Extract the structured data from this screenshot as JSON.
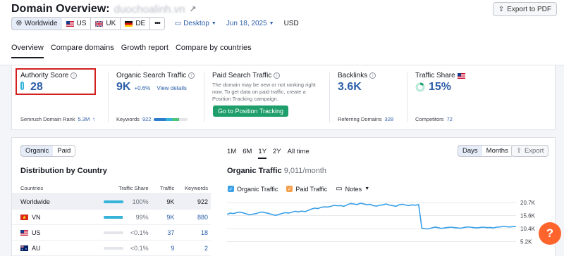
{
  "header": {
    "title": "Domain Overview:",
    "domain": "duochoalinh.vn",
    "export_label": "Export to PDF"
  },
  "controls": {
    "databases": [
      {
        "label": "Worldwide",
        "selected": true
      },
      {
        "label": "US",
        "selected": false
      },
      {
        "label": "UK",
        "selected": false
      },
      {
        "label": "DE",
        "selected": false
      }
    ],
    "more_label": "•••",
    "device": "Desktop",
    "date": "Jun 18, 2025",
    "currency": "USD"
  },
  "tabs": [
    "Overview",
    "Compare domains",
    "Growth report",
    "Compare by countries"
  ],
  "active_tab": "Overview",
  "metrics": {
    "authority": {
      "label": "Authority Score",
      "value": "28",
      "foot_label": "Semrush Domain Rank",
      "foot_value": "5.3M",
      "foot_arrow": "↑"
    },
    "organic": {
      "label": "Organic Search Traffic",
      "value": "9K",
      "delta": "+0.6%",
      "link": "View details",
      "foot_label": "Keywords",
      "foot_value": "922"
    },
    "paid": {
      "label": "Paid Search Traffic",
      "text": "The domain may be new or not ranking right now. To get data on paid traffic, create a Position Tracking campaign.",
      "button": "Go to Position Tracking"
    },
    "backlinks": {
      "label": "Backlinks",
      "value": "3.6K",
      "foot_label": "Referring Domains",
      "foot_value": "328"
    },
    "share": {
      "label": "Traffic Share",
      "value": "15%",
      "share_fraction": 0.15,
      "foot_label": "Competitors",
      "foot_value": "72"
    }
  },
  "panel": {
    "toggle": [
      {
        "label": "Organic",
        "selected": true
      },
      {
        "label": "Paid",
        "selected": false
      }
    ],
    "distribution_title": "Distribution by Country",
    "table_headers": {
      "country": "Countries",
      "share": "Traffic Share",
      "traffic": "Traffic",
      "keywords": "Keywords"
    },
    "rows": [
      {
        "country": "Worldwide",
        "flag": "none",
        "share": "100%",
        "share_fill": 1.0,
        "traffic": "9K",
        "keywords": "922",
        "linked": false
      },
      {
        "country": "VN",
        "flag": "vn",
        "share": "99%",
        "share_fill": 0.99,
        "traffic": "9K",
        "keywords": "880",
        "linked": true
      },
      {
        "country": "US",
        "flag": "us",
        "share": "<0.1%",
        "share_fill": 0.0,
        "traffic": "37",
        "keywords": "18",
        "linked": true
      },
      {
        "country": "AU",
        "flag": "au",
        "share": "<0.1%",
        "share_fill": 0.0,
        "traffic": "9",
        "keywords": "2",
        "linked": true
      }
    ],
    "ranges": [
      "1M",
      "6M",
      "1Y",
      "2Y",
      "All time"
    ],
    "active_range": "1Y",
    "granularity": [
      {
        "label": "Days",
        "selected": true
      },
      {
        "label": "Months",
        "selected": false
      }
    ],
    "export_label": "Export",
    "chart_title": "Organic Traffic",
    "chart_subtitle": "9,011/month",
    "legend": [
      {
        "label": "Organic Traffic",
        "color": "#3aa0e8",
        "checked": true
      },
      {
        "label": "Paid Traffic",
        "color": "#f5a04a",
        "checked": true
      }
    ],
    "notes_label": "Notes",
    "help_label": "?"
  },
  "chart_data": {
    "type": "line",
    "title": "Organic Traffic",
    "y_ticks": [
      "20.7K",
      "15.6K",
      "10.4K",
      "5.2K"
    ],
    "ylim": [
      0,
      20700
    ],
    "series": [
      {
        "name": "Organic Traffic",
        "color": "#3aa0e8",
        "values": [
          16000,
          16500,
          16300,
          16700,
          16900,
          16600,
          16200,
          15800,
          16100,
          16300,
          16800,
          16900,
          16600,
          16300,
          15900,
          15600,
          16000,
          16400,
          16700,
          16500,
          16900,
          17200,
          17000,
          17300,
          17100,
          17600,
          18100,
          18500,
          18300,
          18800,
          19000,
          18900,
          19200,
          19600,
          19400,
          19500,
          19200,
          19800,
          20300,
          20100,
          19900,
          20400,
          20200,
          19800,
          20000,
          19500,
          19300,
          19600,
          19800,
          20100,
          19700,
          19500,
          19200,
          19800,
          20000,
          19700,
          19500,
          19800,
          19600,
          19900,
          10500,
          10300,
          10200,
          10600,
          10900,
          10700,
          10400,
          10600,
          10800,
          10900,
          10700,
          10600,
          10500,
          10800,
          11000,
          10900,
          10700,
          10600,
          10800,
          10900,
          10700,
          10800,
          10600,
          10900,
          11000,
          11200,
          11100,
          11000,
          11100,
          11200
        ]
      }
    ]
  }
}
